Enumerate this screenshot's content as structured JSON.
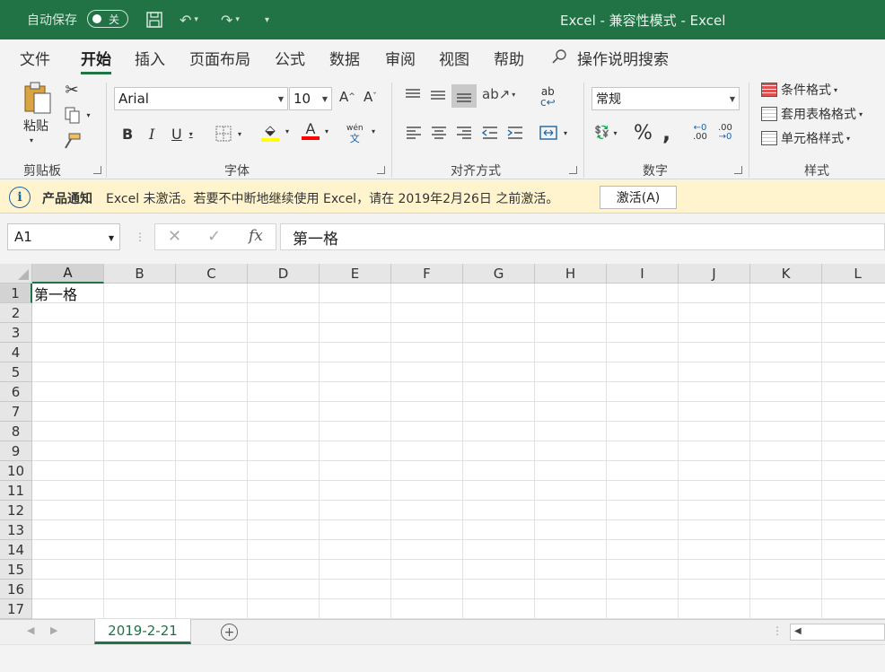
{
  "titlebar": {
    "autosave_label": "自动保存",
    "autosave_state": "关",
    "title": "Excel  -  兼容性模式  -  Excel"
  },
  "tabs": [
    {
      "label": "文件"
    },
    {
      "label": "开始"
    },
    {
      "label": "插入"
    },
    {
      "label": "页面布局"
    },
    {
      "label": "公式"
    },
    {
      "label": "数据"
    },
    {
      "label": "审阅"
    },
    {
      "label": "视图"
    },
    {
      "label": "帮助"
    }
  ],
  "tellme": "操作说明搜索",
  "ribbon": {
    "clipboard": {
      "paste": "粘贴",
      "group": "剪贴板"
    },
    "font": {
      "name": "Arial",
      "size": "10",
      "group": "字体",
      "wen": "wén",
      "wen2": "文"
    },
    "alignment": {
      "group": "对齐方式"
    },
    "number": {
      "format": "常规",
      "group": "数字"
    },
    "styles": {
      "conditional": "条件格式",
      "table": "套用表格格式",
      "cell": "单元格样式",
      "group": "样式"
    },
    "colors": {
      "highlight": "#ffff00",
      "font_color": "#ff0000"
    }
  },
  "notice": {
    "title": "产品通知",
    "text": "Excel 未激活。若要不中断地继续使用 Excel，请在 2019年2月26日 之前激活。",
    "button": "激活(A)"
  },
  "formula": {
    "namebox": "A1",
    "value": "第一格"
  },
  "grid": {
    "columns": [
      "A",
      "B",
      "C",
      "D",
      "E",
      "F",
      "G",
      "H",
      "I",
      "J",
      "K",
      "L"
    ],
    "rows": [
      "1",
      "2",
      "3",
      "4",
      "5",
      "6",
      "7",
      "8",
      "9",
      "10",
      "11",
      "12",
      "13",
      "14",
      "15",
      "16",
      "17"
    ],
    "a1_value": "第一格"
  },
  "sheets": [
    {
      "name": "2019-2-21"
    }
  ]
}
